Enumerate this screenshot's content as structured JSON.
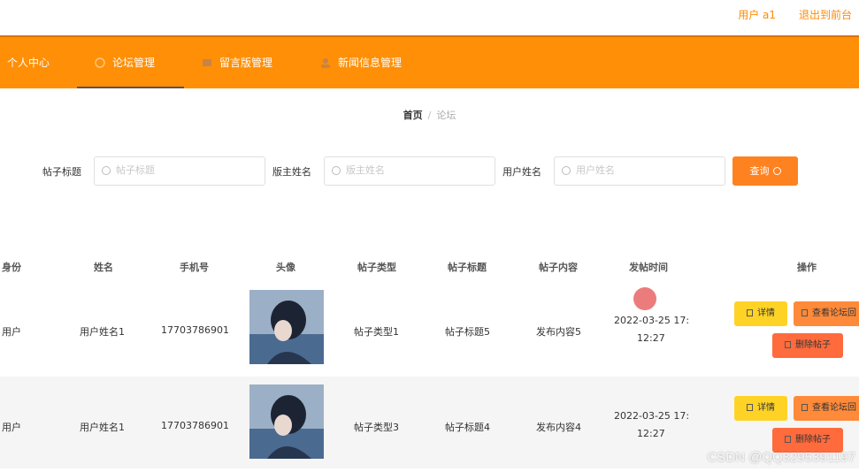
{
  "header": {
    "user": "用户 a1",
    "exit": "退出到前台"
  },
  "nav": {
    "items": [
      {
        "label": "个人中心"
      },
      {
        "label": "论坛管理"
      },
      {
        "label": "留言版管理"
      },
      {
        "label": "新闻信息管理"
      }
    ]
  },
  "breadcrumb": {
    "home": "首页",
    "sep": "/",
    "current": "论坛"
  },
  "search": {
    "title_label": "帖子标题",
    "title_placeholder": "帖子标题",
    "owner_label": "版主姓名",
    "owner_placeholder": "版主姓名",
    "user_label": "用户姓名",
    "user_placeholder": "用户姓名",
    "query_button": "查询"
  },
  "table": {
    "headers": [
      "身份",
      "姓名",
      "手机号",
      "头像",
      "帖子类型",
      "帖子标题",
      "帖子内容",
      "发帖时间",
      "操作"
    ],
    "rows": [
      {
        "role": "用户",
        "name": "用户姓名1",
        "phone": "17703786901",
        "type": "帖子类型1",
        "title": "帖子标题5",
        "content": "发布内容5",
        "time1": "2022-03-25 17:",
        "time2": "12:27"
      },
      {
        "role": "用户",
        "name": "用户姓名1",
        "phone": "17703786901",
        "type": "帖子类型3",
        "title": "帖子标题4",
        "content": "发布内容4",
        "time1": "2022-03-25 17:",
        "time2": "12:27"
      }
    ],
    "actions": {
      "detail": "详情",
      "view": "查看论坛回",
      "delete": "删除帖子"
    }
  },
  "watermark": "CSDN @QQ3295391197",
  "colors": {
    "accent": "#ff8f06",
    "detail": "#ffd326",
    "view": "#ff8a3a",
    "delete": "#ff6b3d"
  }
}
